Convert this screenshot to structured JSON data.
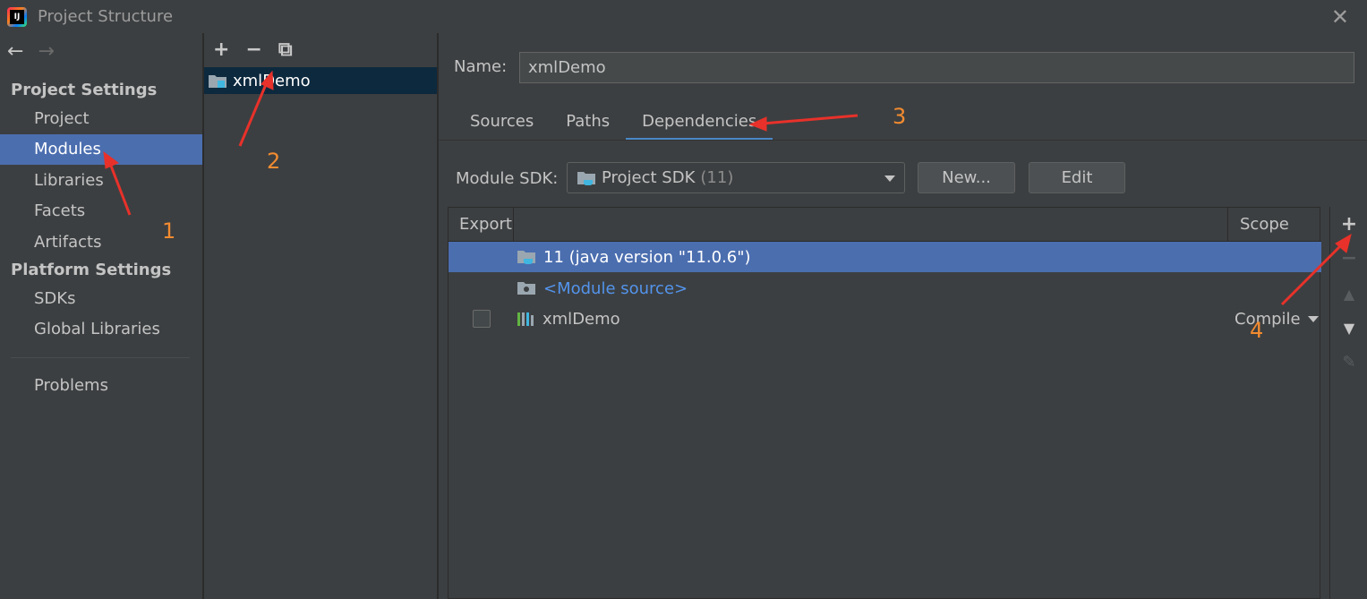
{
  "window": {
    "title": "Project Structure",
    "close_icon": "close-icon"
  },
  "sidebar": {
    "project_settings_header": "Project Settings",
    "platform_settings_header": "Platform Settings",
    "items": [
      {
        "label": "Project"
      },
      {
        "label": "Modules",
        "selected": true
      },
      {
        "label": "Libraries"
      },
      {
        "label": "Facets"
      },
      {
        "label": "Artifacts"
      }
    ],
    "platform_items": [
      {
        "label": "SDKs"
      },
      {
        "label": "Global Libraries"
      }
    ],
    "problems_label": "Problems"
  },
  "modules_panel": {
    "add_glyph": "+",
    "remove_glyph": "−",
    "copy_glyph": "⧉",
    "module_name": "xmlDemo"
  },
  "main": {
    "name_label": "Name:",
    "name_value": "xmlDemo",
    "tabs": [
      {
        "label": "Sources"
      },
      {
        "label": "Paths"
      },
      {
        "label": "Dependencies",
        "active": true
      }
    ],
    "module_sdk_label": "Module SDK:",
    "sdk_value": "Project SDK",
    "sdk_version": "(11)",
    "new_button": "New...",
    "edit_button": "Edit",
    "table": {
      "col_export": "Export",
      "col_scope": "Scope",
      "rows": [
        {
          "text": "11 (java version \"11.0.6\")",
          "selected": true
        },
        {
          "text": "<Module source>",
          "link": true
        },
        {
          "text": "xmlDemo",
          "checkbox": false,
          "scope": "Compile"
        }
      ]
    },
    "side_tools": [
      "+",
      "−",
      "▲",
      "▼",
      "✎"
    ]
  },
  "annotations": [
    "1",
    "2",
    "3",
    "4"
  ],
  "colors": {
    "background": "#3c3f41",
    "selection": "#4b6eaf",
    "module_selection": "#0d293e",
    "link": "#5394ec",
    "annotation": "#f28b30",
    "arrow": "#e8312a"
  }
}
